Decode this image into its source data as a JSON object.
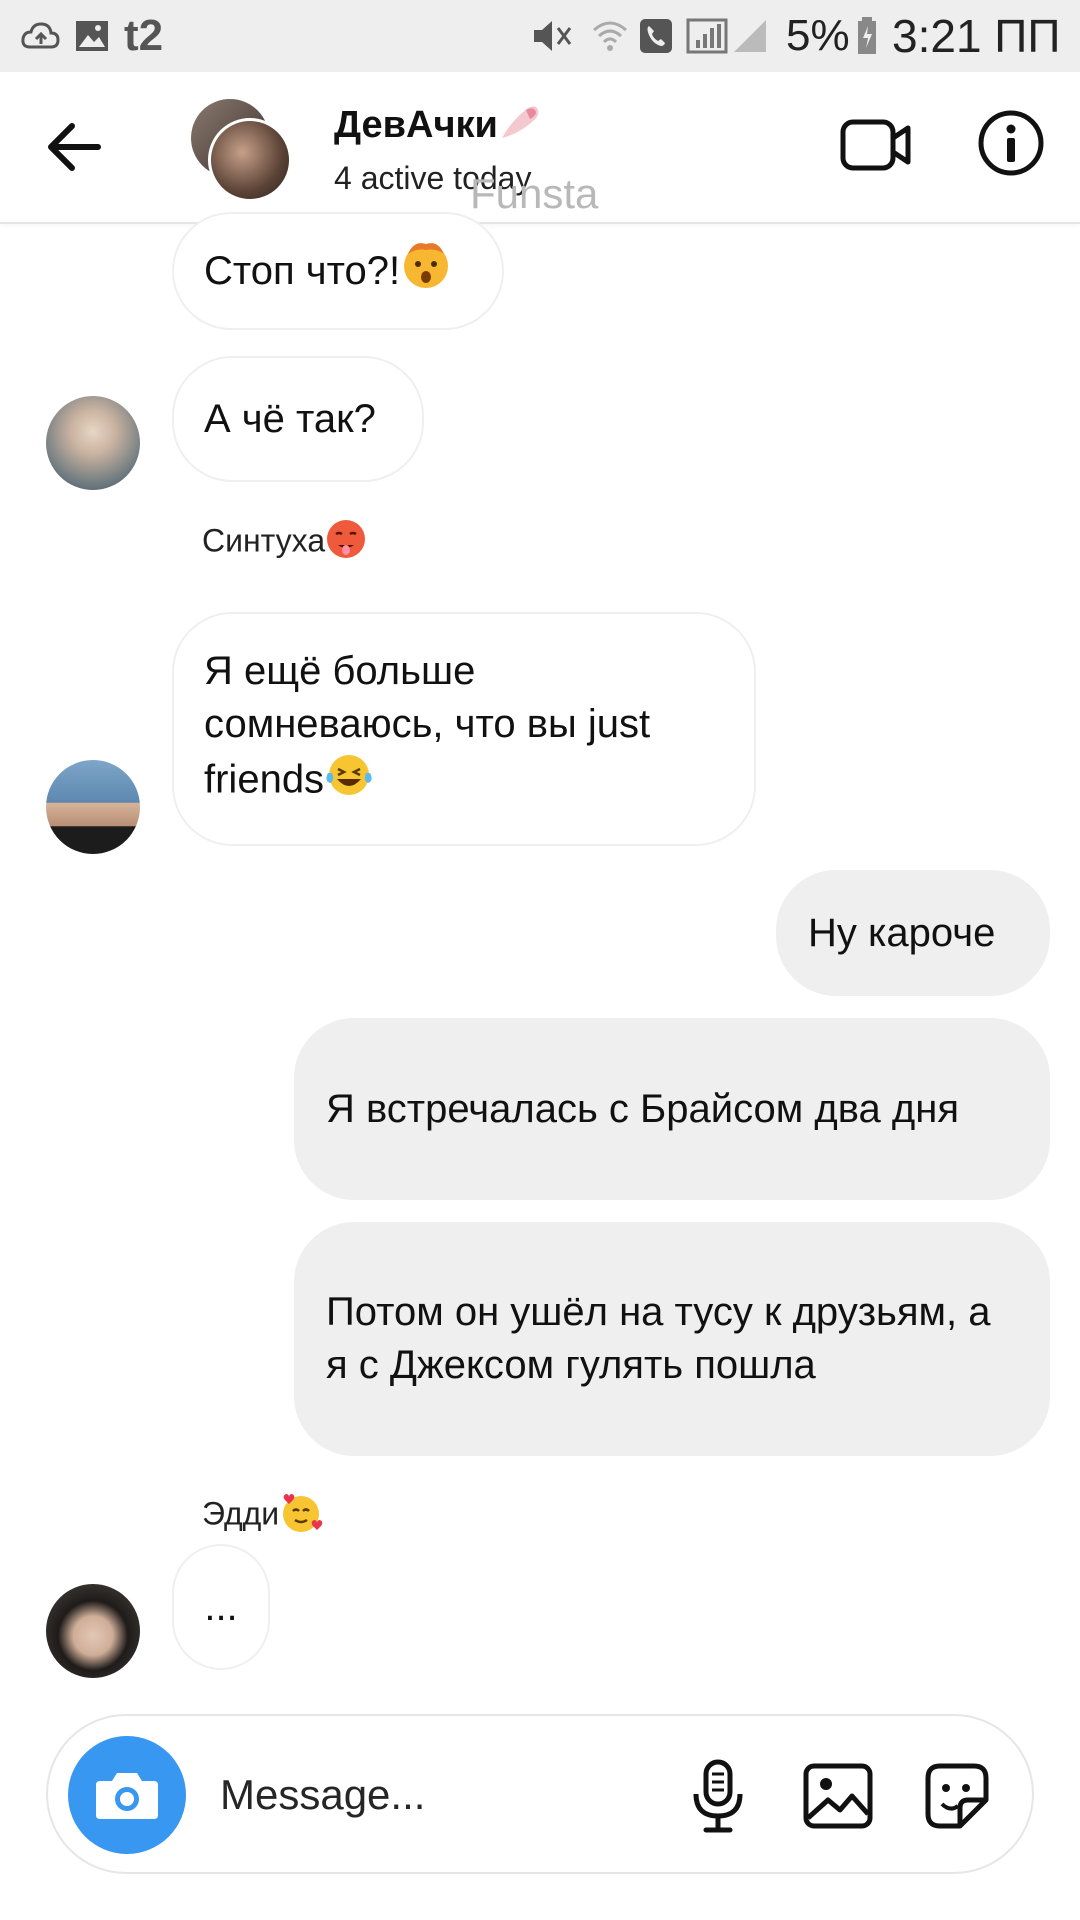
{
  "status_bar": {
    "carrier": "t2",
    "battery": "5%",
    "time": "3:21 ПП"
  },
  "header": {
    "title": "ДевАчки",
    "subtitle": "4 active today",
    "watermark": "Funsta"
  },
  "messages": [
    {
      "type": "incoming",
      "text": "Стоп что?!"
    },
    {
      "type": "incoming",
      "text": "А чё так?"
    },
    {
      "type": "sender",
      "text": "Синтуха"
    },
    {
      "type": "incoming",
      "text": "Я ещё больше сомневаюсь, что вы just friends"
    },
    {
      "type": "outgoing",
      "text": "Ну кароче"
    },
    {
      "type": "outgoing",
      "text": "Я встречалась с Брайсом два дня"
    },
    {
      "type": "outgoing",
      "text": "Потом он ушёл на тусу к друзьям, а я с Джексом гулять пошла"
    },
    {
      "type": "sender",
      "text": "Эдди"
    },
    {
      "type": "incoming",
      "text": "..."
    }
  ],
  "composer": {
    "placeholder": "Message..."
  },
  "colors": {
    "accent": "#3897f0",
    "outgoing_bubble": "#efefef",
    "status_bar": "#eeeeee"
  },
  "icons": [
    "back-arrow-icon",
    "video-call-icon",
    "info-icon",
    "camera-icon",
    "microphone-icon",
    "gallery-icon",
    "sticker-icon",
    "shocked-face-emoji",
    "hot-face-emoji",
    "laughing-tears-emoji",
    "hearts-face-emoji",
    "nail-polish-emoji"
  ]
}
